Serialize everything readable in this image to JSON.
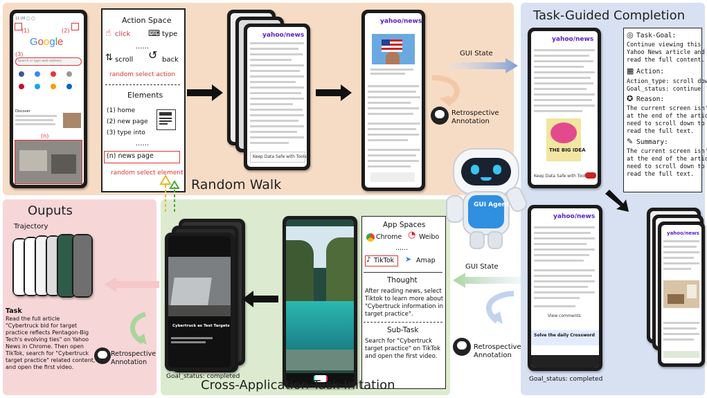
{
  "random_walk": {
    "title": "Random Walk",
    "callouts": [
      "(1)",
      "(2)",
      "(3)",
      "(n)"
    ],
    "action_space": {
      "heading": "Action Space",
      "click": "click",
      "type": "type",
      "dots": "......",
      "scroll": "scroll",
      "back": "back",
      "random_action": "random  select action"
    },
    "elements": {
      "heading": "Elements",
      "items": [
        "(1) home",
        "(2) new page",
        "(3) type into"
      ],
      "dots": "......",
      "news_page": "(n) news page",
      "random_element": "random  select element"
    },
    "google_screen": {
      "logo": "Google",
      "search_placeholder": "Search or type web address",
      "discover": "Discover"
    }
  },
  "labels": {
    "gui_state": "GUI State",
    "retro_1": "Retrospective",
    "retro_2": "Annotation"
  },
  "task_guided": {
    "title": "Task-Guided Completion",
    "task_goal_head": "Task-Goal:",
    "task_goal_body": [
      "Continue viewing this",
      "Yahoo News article and",
      "read the full content."
    ],
    "action_head": "Action:",
    "action_type": "Action_type: scroll down",
    "goal_status": "Goal_status: continue",
    "reason_head": "Reason:",
    "reason_body": [
      "The current screen isn't",
      "at the end of the article;",
      "need to scroll down to",
      "read the full text."
    ],
    "summary_head": "Summary:",
    "summary_body": [
      "The current screen isn't",
      "at the end of the article;",
      "need to scroll down to",
      "read the full text."
    ],
    "goal_completed": "Goal_status: completed",
    "yahoo": "yahoo/news",
    "ad_text": "Keep Data Safe with Tools",
    "big_idea": "THE BIG IDEA",
    "crossword": "Solve the daily Crossword",
    "view_comments": "View comments"
  },
  "outputs": {
    "title": "Ouputs",
    "trajectory": "Trajectory",
    "task_head": "Task",
    "task_body": [
      "Read the full article",
      "\"Cybertruck bid for target",
      "practice reflects Pentagon-Big",
      "Tech's evolving ties\" on Yahoo",
      "News in Chrome. Then open",
      "TikTok, search for \"Cybertruck",
      "target practice\" related content,",
      "and open the first video."
    ]
  },
  "cross_app": {
    "title": "Cross-Application Task Initation",
    "app_spaces": "App Spaces",
    "apps": [
      "Chrome",
      "Weibo",
      "TikTok",
      "Amap"
    ],
    "dots": "......",
    "thought_head": "Thought",
    "thought_body": [
      "After reading news, select",
      "Tiktok to learn more about",
      "\"Cybertruck information in",
      "target practice\"."
    ],
    "subtask_head": "Sub-Task",
    "subtask_body": [
      "Search for \"Cybertruck",
      "target practice\" on TikTok",
      "and open the first video."
    ],
    "goal_completed": "Goal_status: completed",
    "video_caption": "Cybertruck as Test Targets"
  },
  "robot": {
    "badge": "GUI Agent"
  },
  "colors": {
    "random_walk_bg": "#f7dcc5",
    "task_guided_bg": "#d7e1f2",
    "outputs_bg": "#f7d6d8",
    "cross_app_bg": "#dcebcf",
    "accent_red": "#d33333",
    "yahoo_purple": "#5b1fc3",
    "robot_blue": "#2f8fe0"
  }
}
